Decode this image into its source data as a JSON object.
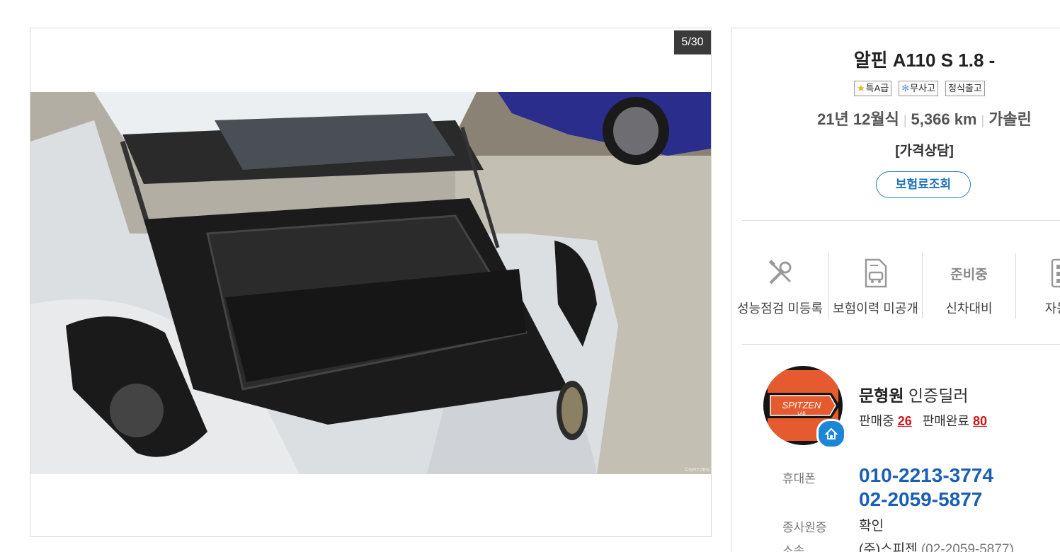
{
  "gallery": {
    "counter": "5/30",
    "watermark": "©SPITZEN"
  },
  "listing": {
    "title": "알핀 A110 S 1.8 -",
    "badges": [
      {
        "icon": "star-icon",
        "label": "특A급"
      },
      {
        "icon": "cross-icon",
        "label": "무사고"
      },
      {
        "icon": "",
        "label": "정식출고"
      }
    ],
    "specs": {
      "year": "21년 12월식",
      "mileage": "5,366 km",
      "fuel": "가솔린"
    },
    "price": "[가격상담]",
    "insurance_button": "보험료조회"
  },
  "status": [
    {
      "icon": "tools-icon",
      "label": "성능점검 미등록"
    },
    {
      "icon": "document-car-icon",
      "label": "보험이력 미공개"
    },
    {
      "icon_text": "준비중",
      "label": "신차대비"
    },
    {
      "icon": "grid-icon",
      "label": "자동차"
    }
  ],
  "dealer": {
    "logo_text": "SPITZEN",
    "logo_sub": "LAB",
    "name": "문형원",
    "role": "인증딜러",
    "selling_label": "판매중",
    "selling_count": "26",
    "sold_label": "판매완료",
    "sold_count": "80",
    "phone_label": "휴대폰",
    "phone_1": "010-2213-3774",
    "phone_2": "02-2059-5877",
    "employee_label": "종사원증",
    "employee_value": "확인",
    "company_label": "소속",
    "company_value": "(주)스피젠",
    "company_phone": "(02-2059-5877)"
  },
  "colors": {
    "accent_blue": "#1a5fb4",
    "count_red": "#d4141b",
    "logo_orange": "#e65a2f"
  }
}
